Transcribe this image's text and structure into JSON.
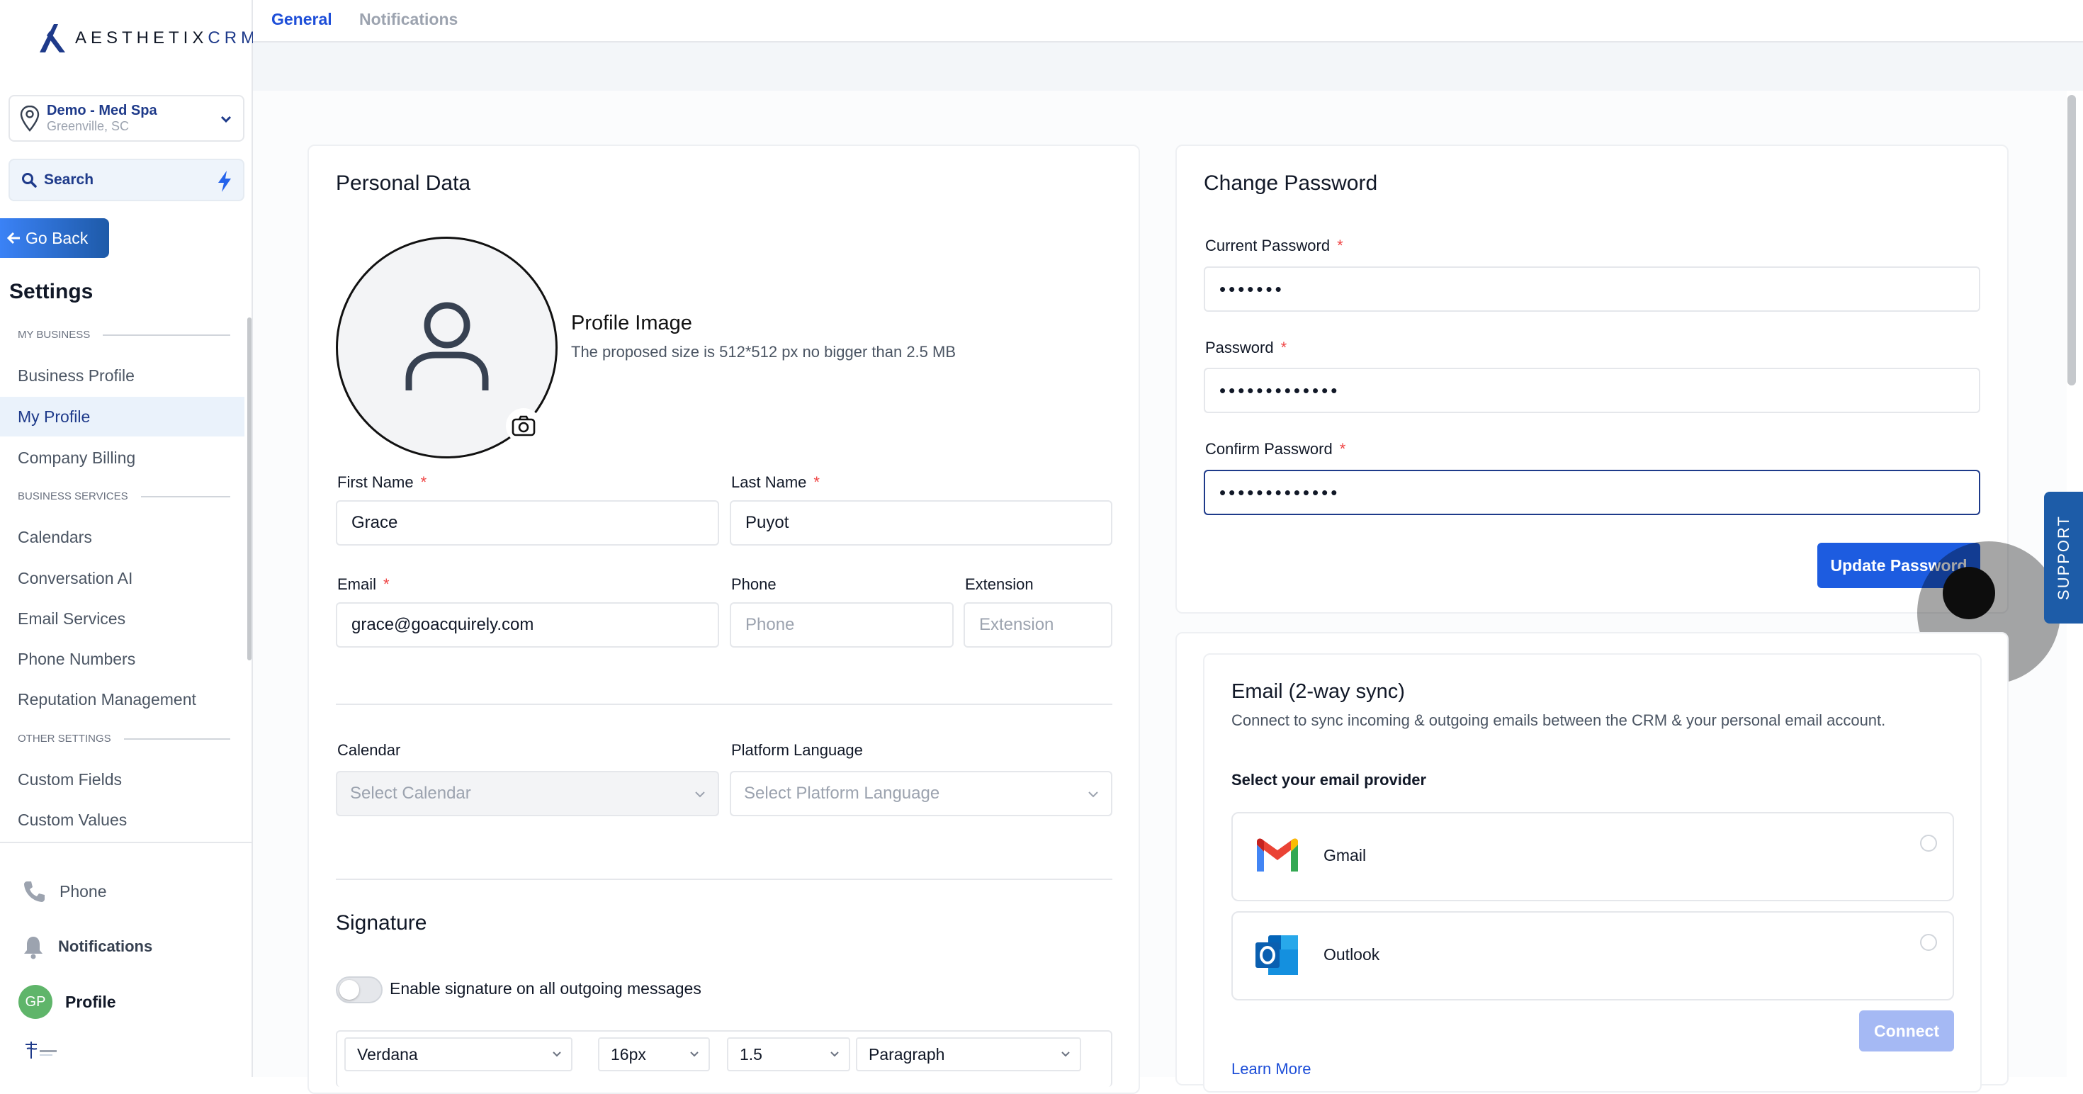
{
  "brand": {
    "word_left": "AESTHETIX",
    "word_right": "CRM"
  },
  "location": {
    "name": "Demo - Med Spa",
    "city": "Greenville, SC"
  },
  "search": {
    "label": "Search"
  },
  "go_back": "Go Back",
  "settings_title": "Settings",
  "sections": {
    "my_business": "MY BUSINESS",
    "business_services": "BUSINESS SERVICES",
    "other_settings": "OTHER SETTINGS"
  },
  "nav": {
    "business_profile": "Business Profile",
    "my_profile": "My Profile",
    "company_billing": "Company Billing",
    "calendars": "Calendars",
    "conversation_ai": "Conversation AI",
    "email_services": "Email Services",
    "phone_numbers": "Phone Numbers",
    "reputation_management": "Reputation Management",
    "custom_fields": "Custom Fields",
    "custom_values": "Custom Values"
  },
  "bottom_nav": {
    "phone": "Phone",
    "notifications": "Notifications",
    "profile": "Profile",
    "avatar_initials": "GP"
  },
  "tabs": {
    "general": "General",
    "notifications": "Notifications"
  },
  "personal": {
    "title": "Personal Data",
    "profile_image_title": "Profile Image",
    "profile_image_hint": "The proposed size is 512*512 px no bigger than 2.5 MB",
    "first_name_label": "First Name",
    "first_name": "Grace",
    "last_name_label": "Last Name",
    "last_name": "Puyot",
    "email_label": "Email",
    "email": "grace@goacquirely.com",
    "phone_label": "Phone",
    "phone_placeholder": "Phone",
    "extension_label": "Extension",
    "extension_placeholder": "Extension",
    "calendar_label": "Calendar",
    "calendar_placeholder": "Select Calendar",
    "language_label": "Platform Language",
    "language_placeholder": "Select Platform Language",
    "required_mark": "*"
  },
  "signature": {
    "title": "Signature",
    "toggle_label": "Enable signature on all outgoing messages",
    "font": "Verdana",
    "size": "16px",
    "line_height": "1.5",
    "block": "Paragraph"
  },
  "password": {
    "title": "Change Password",
    "current_label": "Current Password",
    "current_value": "•••••••",
    "new_label": "Password",
    "new_value": "•••••••••••••",
    "confirm_label": "Confirm Password",
    "confirm_value": "•••••••••••••",
    "update_button": "Update Password"
  },
  "email_sync": {
    "title": "Email (2-way sync)",
    "description": "Connect to sync incoming & outgoing emails between the CRM & your personal email account.",
    "provider_prompt": "Select your email provider",
    "gmail": "Gmail",
    "outlook": "Outlook",
    "connect_button": "Connect",
    "learn_more": "Learn More"
  },
  "support": "SUPPORT",
  "colors": {
    "accent": "#1d5ce0",
    "brand_navy": "#1e3a8a",
    "active_nav_bg": "#eaf2fb"
  }
}
